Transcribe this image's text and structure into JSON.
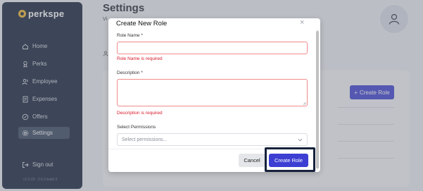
{
  "brand": {
    "name": "perkspe"
  },
  "sidebar": {
    "items": [
      {
        "label": "Home",
        "icon": "home-icon"
      },
      {
        "label": "Perks",
        "icon": "perks-icon"
      },
      {
        "label": "Employee",
        "icon": "employee-icon"
      },
      {
        "label": "Expenses",
        "icon": "expenses-icon"
      },
      {
        "label": "Offers",
        "icon": "offers-icon"
      },
      {
        "label": "Settings",
        "icon": "settings-icon",
        "active": true
      }
    ],
    "signout_label": "Sign out",
    "version": "v1.0.23 - 0.0.3-build.3"
  },
  "page": {
    "title": "Settings",
    "subtitle": "Vi"
  },
  "background": {
    "create_role_label": "Create Role"
  },
  "modal": {
    "title": "Create New Role",
    "role_name_label": "Role Name *",
    "role_name_value": "",
    "role_name_error": "Role Name is required",
    "description_label": "Description *",
    "description_value": "",
    "description_error": "Description is required",
    "permissions_label": "Select Permissions",
    "permissions_placeholder": "Select permissions...",
    "cancel_label": "Cancel",
    "create_label": "Create Role"
  },
  "colors": {
    "sidebar_bg": "#132039",
    "accent": "#3c3fd2",
    "error": "#d6182a",
    "brand": "#f3b62c"
  }
}
